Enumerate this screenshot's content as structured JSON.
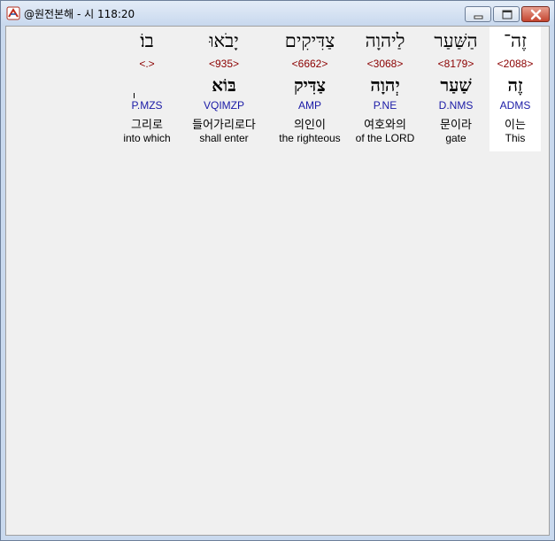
{
  "window": {
    "title": "@원전본해 - 시 118:20"
  },
  "words": [
    {
      "surface": "זֶה־",
      "strong": "<2088>",
      "lemma": "זֶה",
      "morph": "ADMS",
      "korean": "이는",
      "english": "This",
      "selected": true
    },
    {
      "surface": "הַשַּׁעַר",
      "strong": "<8179>",
      "lemma": "שַׁעַר",
      "morph": "D.NMS",
      "korean": "문이라",
      "english": "gate"
    },
    {
      "surface": "לַיהוָה",
      "strong": "<3068>",
      "lemma": "יְהוָה",
      "morph": "P.NE",
      "korean": "여호와의",
      "english": "of the LORD"
    },
    {
      "surface": "צַדִּיקִים",
      "strong": "<6662>",
      "lemma": "צַדִּיק",
      "morph": "AMP",
      "korean": "의인이",
      "english": "the righteous"
    },
    {
      "surface": "יָבֹאוּ",
      "strong": "<935>",
      "lemma": "בּוֹא",
      "morph": "VQIMZP",
      "korean": "들어가리로다",
      "english": "shall enter"
    },
    {
      "surface": "בוֹ׃",
      "strong": "<.>",
      "lemma": "",
      "morph": "P.MZS",
      "korean": "그리로",
      "english": "into which"
    }
  ]
}
